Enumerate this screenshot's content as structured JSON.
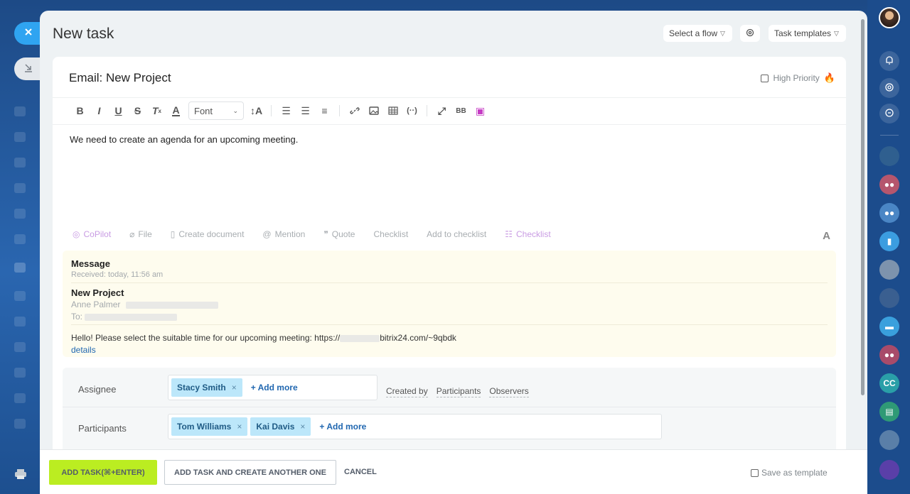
{
  "page": {
    "title": "New task",
    "header": {
      "flow_label": "Select a flow",
      "templates_label": "Task templates"
    }
  },
  "task": {
    "title": "Email: New Project",
    "priority_label": "High Priority",
    "body": "We need to create an agenda for an upcoming meeting."
  },
  "editor": {
    "font_select": "Font",
    "toolbar_icons": [
      "bold-icon",
      "italic-icon",
      "underline-icon",
      "strikethrough-icon",
      "clear-format-icon",
      "text-color-icon",
      "font-size-icon",
      "numbered-list-icon",
      "bullet-list-icon",
      "align-icon",
      "link-icon",
      "image-icon",
      "table-icon",
      "code-icon",
      "fullscreen-icon",
      "bbcode-icon",
      "ai-image-icon"
    ],
    "bb_label": "BB"
  },
  "actions": {
    "copilot": "CoPilot",
    "file": "File",
    "create_document": "Create document",
    "mention": "Mention",
    "quote": "Quote",
    "checklist": "Checklist",
    "add_to_checklist": "Add to checklist",
    "checklist_ai": "Checklist",
    "font_toggle": "A"
  },
  "email": {
    "message_heading": "Message",
    "received": "Received: today, 11:56 am",
    "subject": "New Project",
    "from_name": "Anne Palmer",
    "to_label": "To:",
    "text_before": "Hello! Please select the suitable time for our upcoming meeting: https://",
    "text_after": "bitrix24.com/~9qbdk",
    "details": "details"
  },
  "fields": {
    "assignee_label": "Assignee",
    "assignee_chip": "Stacy Smith",
    "participants_label": "Participants",
    "participant_chips": [
      "Tom Williams",
      "Kai Davis"
    ],
    "add_more": "+ Add more",
    "links": [
      "Created by",
      "Participants",
      "Observers"
    ],
    "remove_symbol": "×"
  },
  "footer": {
    "primary": "ADD TASK(⌘+ENTER)",
    "secondary": "ADD TASK AND CREATE ANOTHER ONE",
    "cancel": "CANCEL",
    "save_template": "Save as template"
  },
  "right_rail": {
    "cc_label": "CC"
  },
  "colors": {
    "accent_blue": "#2fa4f1",
    "primary_button": "#bbed21",
    "chip": "#bce7fa",
    "email_bg": "#fefcee",
    "copilot": "#c99ce3"
  }
}
